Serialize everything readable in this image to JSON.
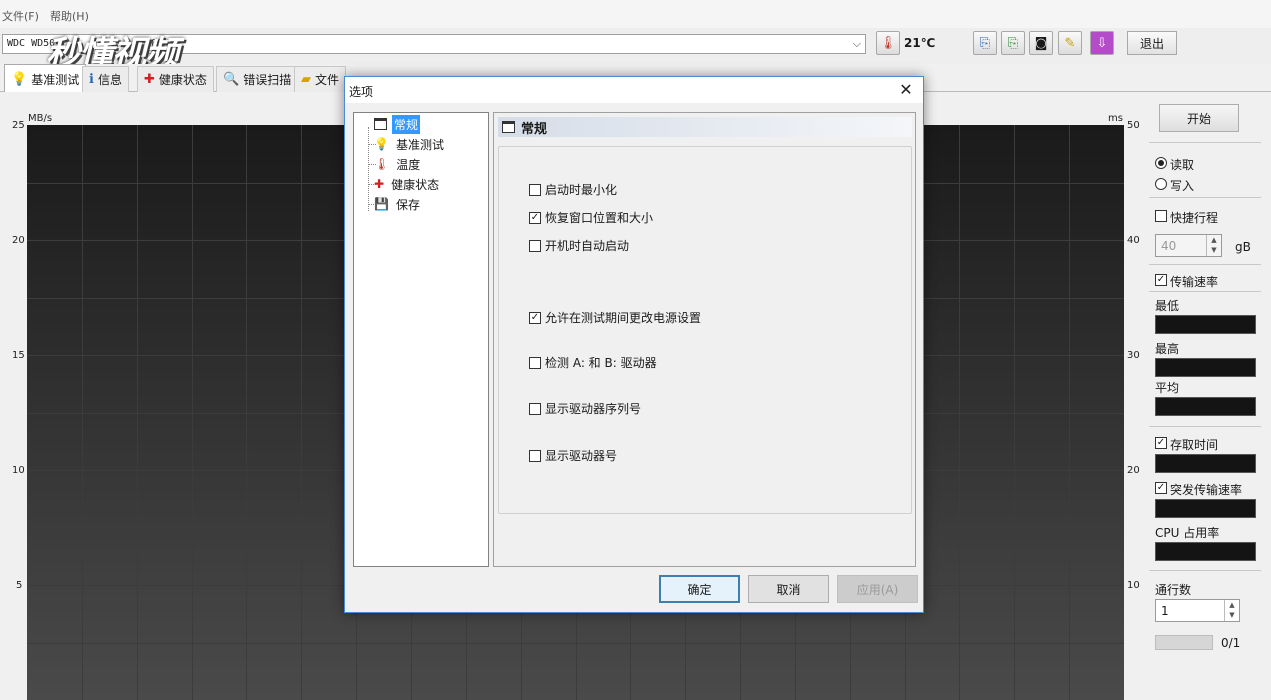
{
  "menu": {
    "file": "文件(F)",
    "help": "帮助(H)"
  },
  "toolbar": {
    "drive": "WDC WD50",
    "drive_suffix": "(500",
    "temperature": "21℃",
    "exit_label": "退出",
    "watermark": "秒懂视频"
  },
  "tabs": [
    {
      "label": "基准测试",
      "icon": "bulb-icon"
    },
    {
      "label": "信息",
      "icon": "info-icon"
    },
    {
      "label": "健康状态",
      "icon": "health-cross-icon"
    },
    {
      "label": "错误扫描",
      "icon": "magnifier-icon"
    },
    {
      "label": "文件",
      "icon": "folder-icon"
    }
  ],
  "chart": {
    "left_unit": "MB/s",
    "right_unit": "ms",
    "left_ticks": [
      "25",
      "20",
      "15",
      "10",
      "5"
    ],
    "right_ticks": [
      "50",
      "40",
      "30",
      "20",
      "10"
    ]
  },
  "right_panel": {
    "start": "开始",
    "read": "读取",
    "write": "写入",
    "quick_stroke": "快捷行程",
    "quick_value": "40",
    "quick_unit": "gB",
    "transfer_rate": "传输速率",
    "min": "最低",
    "max": "最高",
    "avg": "平均",
    "access_time": "存取时间",
    "burst_rate": "突发传输速率",
    "cpu": "CPU 占用率",
    "passes": "通行数",
    "passes_value": "1",
    "progress": "0/1"
  },
  "dialog": {
    "title": "选项",
    "tree": [
      {
        "label": "常规",
        "icon": "window-icon",
        "selected": true
      },
      {
        "label": "基准测试",
        "icon": "bulb-icon",
        "selected": false
      },
      {
        "label": "温度",
        "icon": "thermometer-icon",
        "selected": false
      },
      {
        "label": "健康状态",
        "icon": "health-cross-icon",
        "selected": false
      },
      {
        "label": "保存",
        "icon": "floppy-icon",
        "selected": false
      }
    ],
    "section_title": "常规",
    "options": [
      {
        "label": "启动时最小化",
        "checked": false
      },
      {
        "label": "恢复窗口位置和大小",
        "checked": true
      },
      {
        "label": "开机时自动启动",
        "checked": false
      },
      {
        "label": "允许在测试期间更改电源设置",
        "checked": true
      },
      {
        "label": "检测 A: 和 B: 驱动器",
        "checked": false
      },
      {
        "label": "显示驱动器序列号",
        "checked": false
      },
      {
        "label": "显示驱动器号",
        "checked": false
      }
    ],
    "ok": "确定",
    "cancel": "取消",
    "apply": "应用(A)"
  },
  "colors": {
    "dialog_border": "#4a8ad0",
    "selection": "#3399ff",
    "chart_bg": "#1c1c1c"
  }
}
